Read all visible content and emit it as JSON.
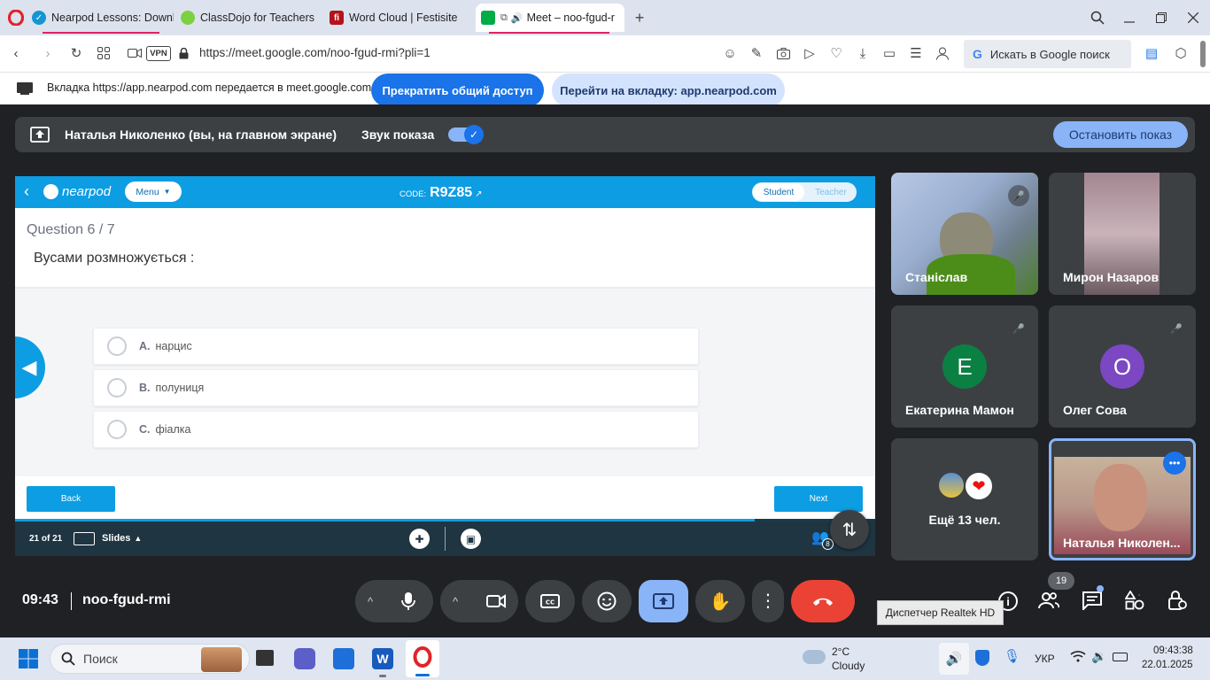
{
  "browser": {
    "tabs": [
      {
        "label": "Nearpod Lessons: Downlo",
        "fav_color": "#1595d3"
      },
      {
        "label": "ClassDojo for Teachers",
        "fav_color": "#7bd141"
      },
      {
        "label": "Word Cloud | Festisite",
        "fav_color": "#b5121b",
        "fav_text": "fi"
      },
      {
        "label": "Meet – noo-fgud-r",
        "fav_color": "#00ac47"
      }
    ],
    "url": "https://meet.google.com/noo-fgud-rmi?pli=1",
    "vpn_label": "VPN",
    "search_placeholder": "Искать в Google поиск"
  },
  "sharebar": {
    "message": "Вкладка https://app.nearpod.com передается в meet.google.com",
    "stop_label": "Прекратить общий доступ",
    "goto_label": "Перейти на вкладку: app.nearpod.com"
  },
  "present": {
    "presenter": "Наталья Николенко (вы, на главном экране)",
    "audio_label": "Звук показа",
    "stop_label": "Остановить показ"
  },
  "nearpod": {
    "logo": "nearpod",
    "menu_label": "Menu",
    "code_label": "CODE:",
    "code": "R9Z85",
    "student_label": "Student",
    "teacher_label": "Teacher",
    "question_num": "Question 6 / 7",
    "question": "Вусами розмножується :",
    "options": [
      {
        "letter": "A.",
        "text": "нарцис"
      },
      {
        "letter": "B.",
        "text": "полуниця"
      },
      {
        "letter": "C.",
        "text": "фіалка"
      }
    ],
    "back_label": "Back",
    "next_label": "Next",
    "slide_counter": "21 of 21",
    "slides_label": "Slides",
    "participants_count": "8",
    "progress": 0.86
  },
  "tiles": {
    "t1": {
      "name": "Станіслав"
    },
    "t2": {
      "name": "Мирон Назаров"
    },
    "t3": {
      "name": "Екатерина Мамон",
      "initial": "Е",
      "color": "#0b8043"
    },
    "t4": {
      "name": "Олег Сова",
      "initial": "О",
      "color": "#7b47c2"
    },
    "t5": {
      "name": "Ещё 13 чел."
    },
    "t6": {
      "name": "Наталья Николен..."
    }
  },
  "controls": {
    "time": "09:43",
    "meeting_code": "noo-fgud-rmi",
    "people_count": "19",
    "tooltip": "Диспетчер Realtek HD"
  },
  "taskbar": {
    "search_placeholder": "Поиск",
    "weather_temp": "2°C",
    "weather_desc": "Cloudy",
    "lang": "УКР",
    "clock_time": "09:43:38",
    "clock_date": "22.01.2025"
  },
  "colors": {
    "nearpod_blue": "#0d9de3",
    "meet_red": "#ea4335",
    "accent_blue": "#8ab4f8"
  }
}
